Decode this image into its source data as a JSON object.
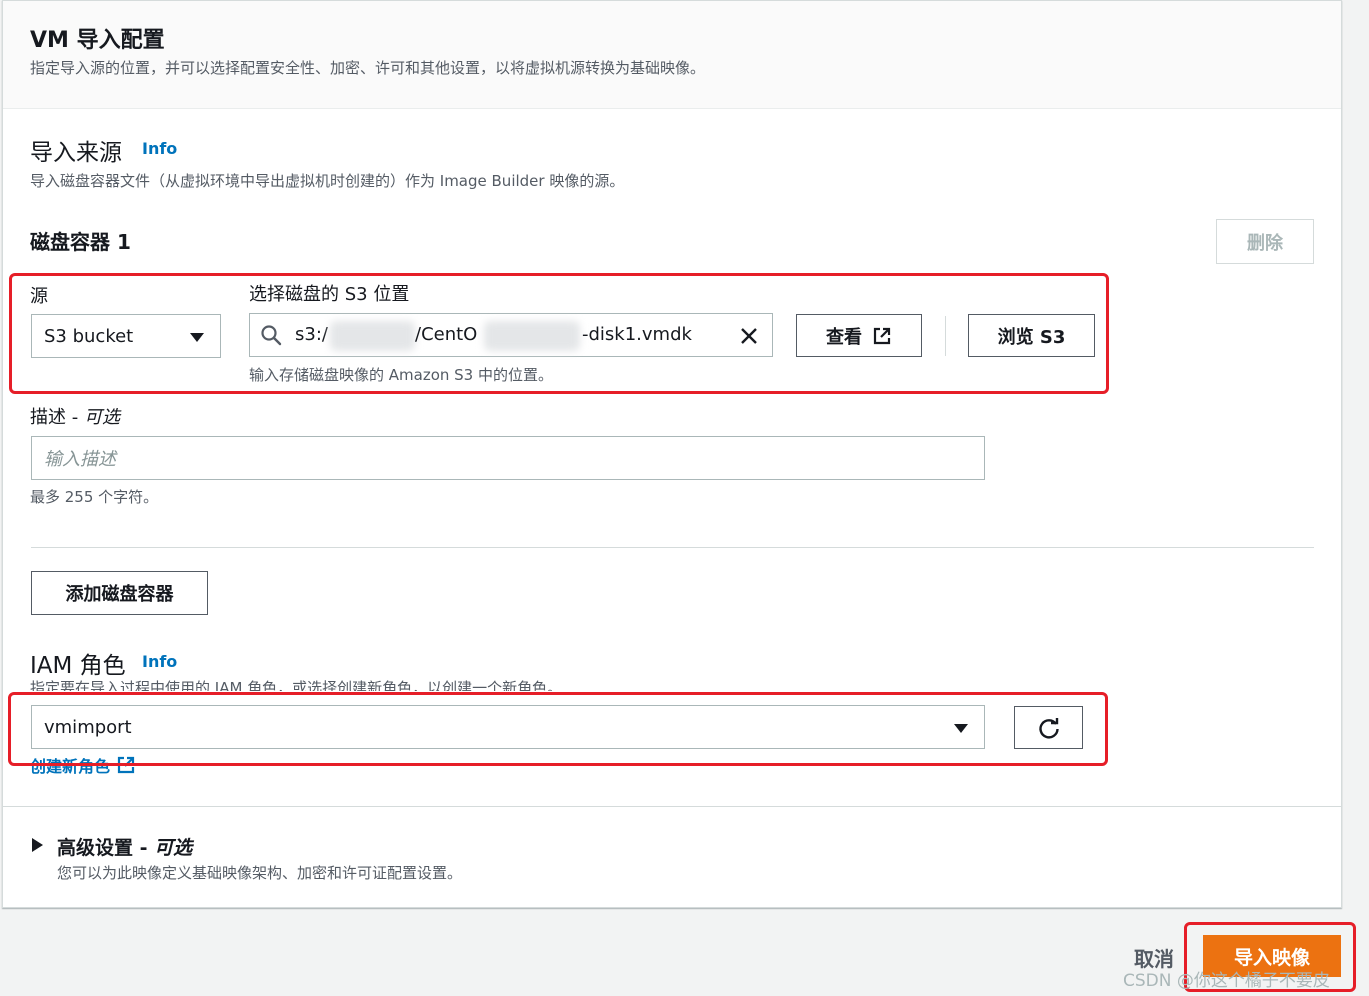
{
  "header": {
    "title": "VM 导入配置",
    "description": "指定导入源的位置，并可以选择配置安全性、加密、许可和其他设置，以将虚拟机源转换为基础映像。"
  },
  "import_source": {
    "title": "导入来源",
    "info": "Info",
    "description": "导入磁盘容器文件（从虚拟环境中导出虚拟机时创建的）作为 Image Builder 映像的源。"
  },
  "disk_container": {
    "title": "磁盘容器 1",
    "delete_label": "删除",
    "source_label": "源",
    "source_value": "S3 bucket",
    "s3_label": "选择磁盘的 S3 位置",
    "s3_value_prefix": "s3:/",
    "s3_value_mid": "/CentO",
    "s3_value_suffix": "-disk1.vmdk",
    "s3_hint": "输入存储磁盘映像的 Amazon S3 中的位置。",
    "view_label": "查看",
    "browse_label": "浏览 S3",
    "description_label": "描述 - ",
    "description_optional": "可选",
    "description_placeholder": "输入描述",
    "description_hint": "最多 255 个字符。"
  },
  "add_disk_label": "添加磁盘容器",
  "iam": {
    "title": "IAM 角色",
    "info": "Info",
    "description": "指定要在导入过程中使用的 IAM 角色，或选择创建新角色，以创建一个新角色。",
    "value": "vmimport",
    "create_label": "创建新角色"
  },
  "advanced": {
    "title": "高级设置 - ",
    "optional": "可选",
    "description": "您可以为此映像定义基础映像架构、加密和许可证配置设置。"
  },
  "footer": {
    "cancel_label": "取消",
    "import_label": "导入映像",
    "watermark": "CSDN @你这个橘子不要皮"
  },
  "colors": {
    "accent": "#ec7211",
    "link": "#0073bb",
    "highlight": "#e61e28"
  }
}
